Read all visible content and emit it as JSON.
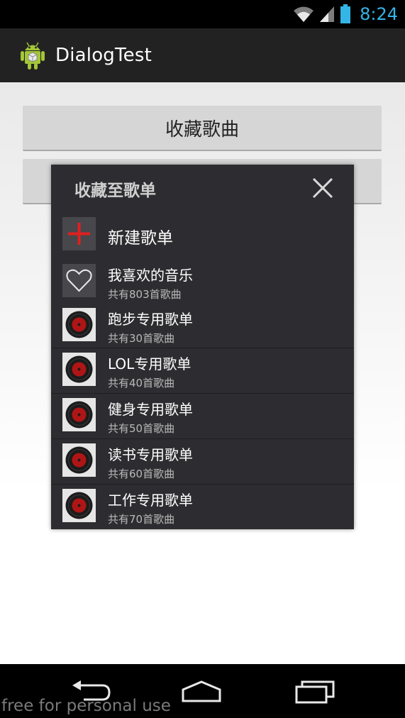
{
  "status_bar": {
    "time": "8:24",
    "icons": [
      "wifi-icon",
      "signal-icon",
      "battery-icon"
    ],
    "time_color": "#33b5e5"
  },
  "action_bar": {
    "title": "DialogTest",
    "icon": "android-robot-icon"
  },
  "buttons": {
    "collect_song": "收藏歌曲"
  },
  "dialog": {
    "title": "收藏至歌单",
    "close_icon": "close-icon",
    "new_playlist_label": "新建歌单",
    "new_playlist_icon": "plus-icon",
    "accent_color": "#e02020",
    "playlists": [
      {
        "name": "我喜欢的音乐",
        "count": "共有803首歌曲",
        "icon": "heart-icon"
      },
      {
        "name": "跑步专用歌单",
        "count": "共有30首歌曲",
        "icon": "record-icon"
      },
      {
        "name": "LOL专用歌单",
        "count": "共有40首歌曲",
        "icon": "record-icon"
      },
      {
        "name": "健身专用歌单",
        "count": "共有50首歌曲",
        "icon": "record-icon"
      },
      {
        "name": "读书专用歌单",
        "count": "共有60首歌曲",
        "icon": "record-icon"
      },
      {
        "name": "工作专用歌单",
        "count": "共有70首歌曲",
        "icon": "record-icon"
      }
    ]
  },
  "nav_bar": {
    "icons": [
      "back-icon",
      "home-icon",
      "recents-icon"
    ]
  },
  "watermark": "free for personal use"
}
